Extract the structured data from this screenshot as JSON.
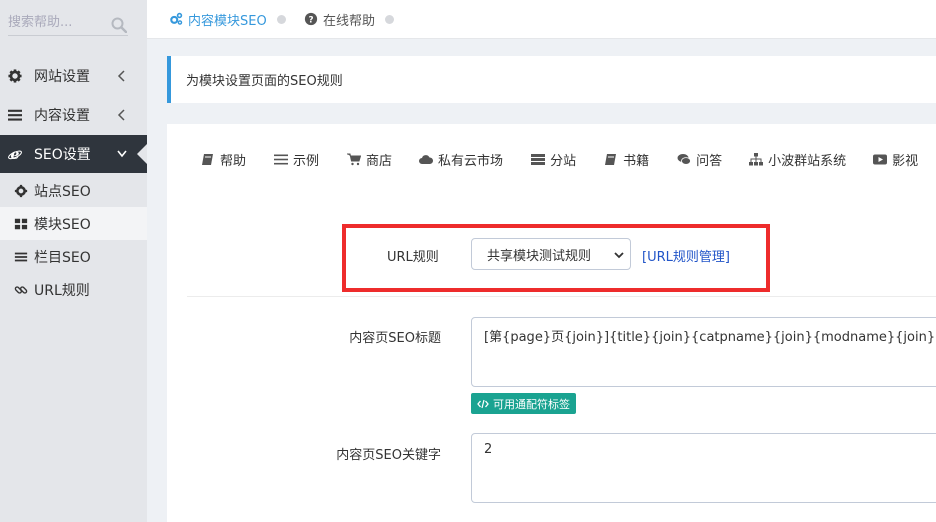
{
  "sidebar": {
    "search_placeholder": "搜索帮助...",
    "menu": [
      {
        "label": "网站设置",
        "icon": "gear-icon"
      },
      {
        "label": "内容设置",
        "icon": "bars-icon"
      },
      {
        "label": "SEO设置",
        "icon": "ie-icon"
      }
    ],
    "submenu": [
      {
        "label": "站点SEO",
        "icon": "gear-icon"
      },
      {
        "label": "模块SEO",
        "icon": "grid-icon"
      },
      {
        "label": "栏目SEO",
        "icon": "list-icon"
      },
      {
        "label": "URL规则",
        "icon": "link-icon"
      }
    ]
  },
  "breadcrumb": {
    "item1": "内容模块SEO",
    "item2": "在线帮助"
  },
  "note": "为模块设置页面的SEO规则",
  "tabs": [
    "帮助",
    "示例",
    "商店",
    "私有云市场",
    "分站",
    "书籍",
    "问答",
    "小波群站系统",
    "影视"
  ],
  "form": {
    "url_rule_label": "URL规则",
    "url_rule_value": "共享模块测试规则",
    "url_rule_link": "[URL规则管理]",
    "title_label": "内容页SEO标题",
    "title_value": "[第{page}页{join}]{title}{join}{catpname}{join}{modname}{join}{SITE_NAME}",
    "badge": "可用通配符标签",
    "keywords_label": "内容页SEO关键字",
    "keywords_value": "2"
  },
  "colors": {
    "accent": "#3598dc",
    "sidebar_active": "#2f353d",
    "highlight": "#ee2c2c",
    "badge": "#1aa391",
    "link": "#2255c8"
  }
}
